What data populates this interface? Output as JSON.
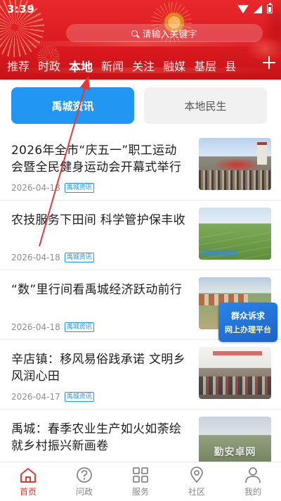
{
  "status_bar": {
    "time": "3:39"
  },
  "search": {
    "placeholder": "请输入关键字"
  },
  "channels": [
    {
      "label": "推荐",
      "active": false
    },
    {
      "label": "时政",
      "active": false
    },
    {
      "label": "本地",
      "active": true
    },
    {
      "label": "新闻",
      "active": false
    },
    {
      "label": "关注",
      "active": false
    },
    {
      "label": "融媒",
      "active": false
    },
    {
      "label": "基层",
      "active": false
    },
    {
      "label": "县",
      "active": false
    }
  ],
  "subtabs": [
    {
      "label": "禹城资讯",
      "active": true
    },
    {
      "label": "本地民生",
      "active": false
    }
  ],
  "news": [
    {
      "title": "2026年全市“庆五一”职工运动会暨全民健身运动会开幕式举行",
      "date": "2026-04-18",
      "tag": "禹城资讯",
      "thumb": "sports-meeting-photo"
    },
    {
      "title": "农技服务下田间  科学管护保丰收",
      "date": "2026-04-18",
      "tag": "禹城资讯",
      "thumb": "farmland-photo"
    },
    {
      "title": "“数”里行间看禹城经济跃动前行",
      "date": "2026-04-18",
      "tag": "禹城资讯",
      "thumb": "aerial-town-photo"
    },
    {
      "title": "辛店镇：移风易俗践承诺    文明乡风润心田",
      "date": "2026-04-17",
      "tag": "禹城资讯",
      "thumb": "meeting-room-photo"
    },
    {
      "title": "禹城：春季农业生产如火如荼绘就乡村振兴新画卷",
      "date": "",
      "tag": "",
      "thumb": "field-aerial-photo"
    }
  ],
  "overlay_badge": {
    "line1": "群众诉求",
    "line2": "网上办理平台"
  },
  "thumb_caption": "勤安卓网",
  "bottom_nav": [
    {
      "label": "首页",
      "icon": "home-icon",
      "active": true
    },
    {
      "label": "问政",
      "icon": "question-icon",
      "active": false
    },
    {
      "label": "服务",
      "icon": "grid-icon",
      "active": false
    },
    {
      "label": "社区",
      "icon": "location-icon",
      "active": false
    },
    {
      "label": "我的",
      "icon": "user-icon",
      "active": false
    }
  ],
  "colors": {
    "header_red": "#e0232a",
    "accent_blue": "#2196f3",
    "active_nav_red": "#e53935",
    "annotation_arrow": "#e53935"
  }
}
